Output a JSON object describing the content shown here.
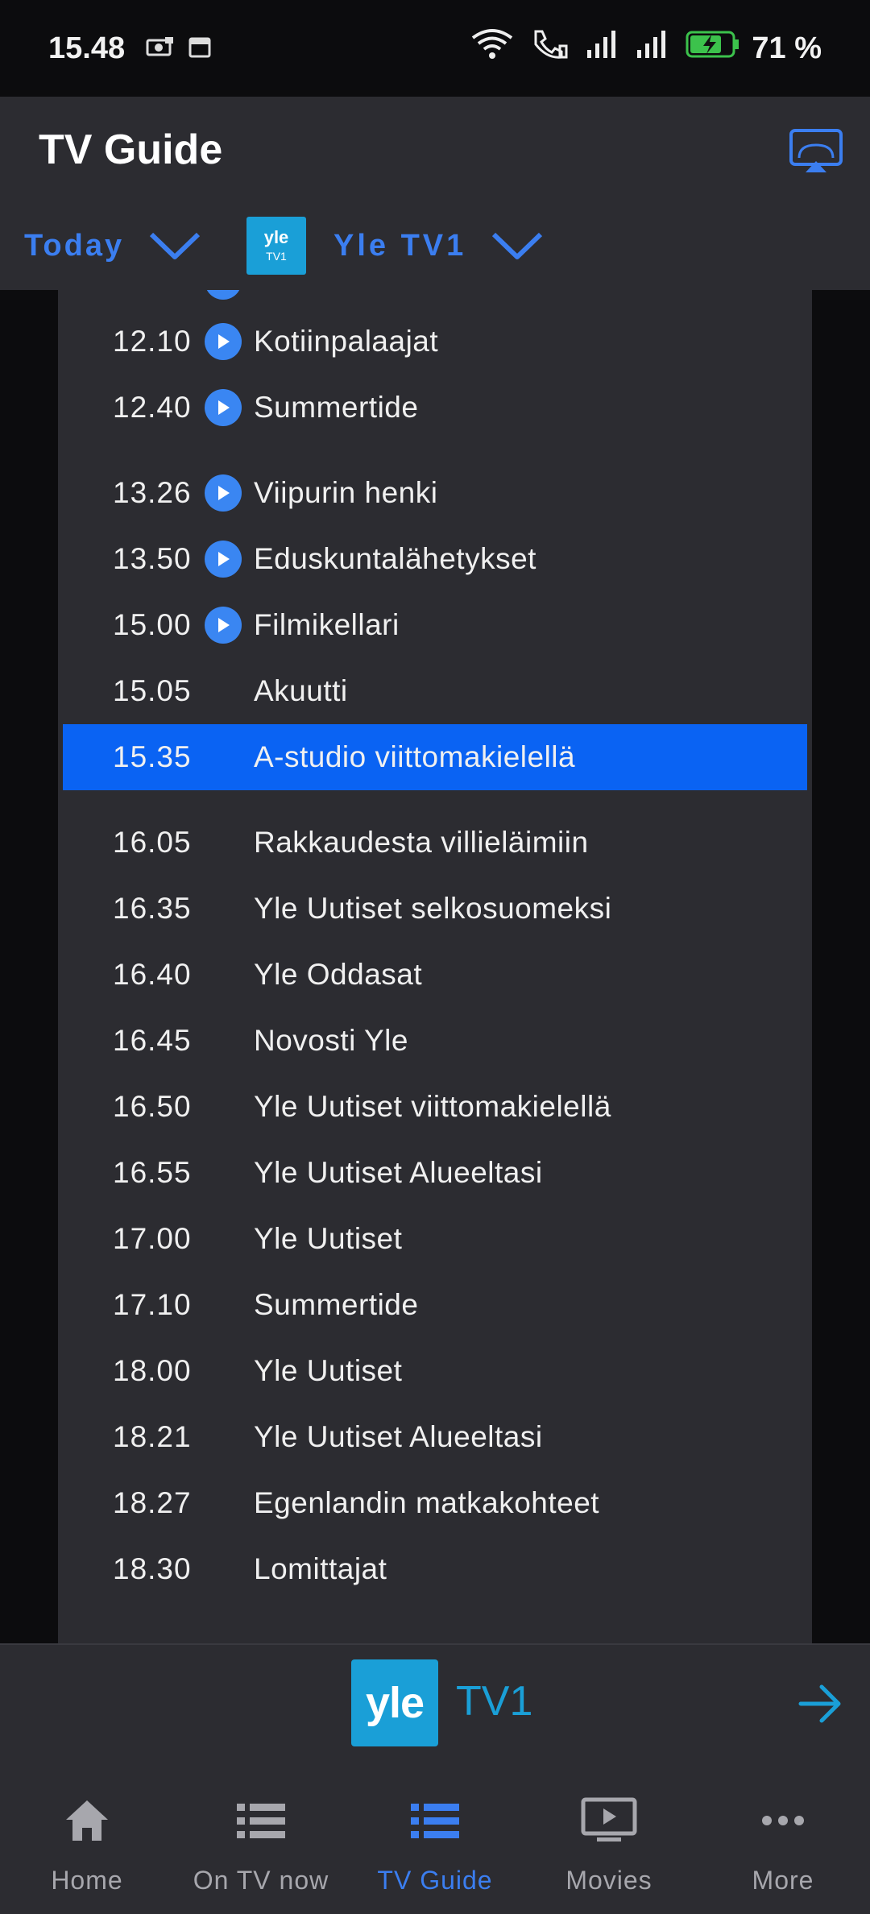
{
  "status_bar": {
    "time": "15.48",
    "battery": "71 %"
  },
  "app_bar": {
    "title": "TV Guide",
    "day": "Today",
    "channel_logo_text": "yle",
    "channel_logo_sub": "TV1",
    "channel": "Yle TV1"
  },
  "schedule": [
    {
      "time": "12.10",
      "title": "Kotiinpalaajat",
      "playable": true
    },
    {
      "time": "12.40",
      "title": "Summertide",
      "playable": true
    },
    {
      "time": "13.26",
      "title": "Viipurin henki",
      "playable": true
    },
    {
      "time": "13.50",
      "title": "Eduskuntalähetykset",
      "playable": true
    },
    {
      "time": "15.00",
      "title": "Filmikellari",
      "playable": true
    },
    {
      "time": "15.05",
      "title": "Akuutti",
      "playable": false
    },
    {
      "time": "15.35",
      "title": "A-studio viittomakielellä",
      "playable": false,
      "now_playing": true
    },
    {
      "time": "16.05",
      "title": "Rakkaudesta villieläimiin",
      "playable": false
    },
    {
      "time": "16.35",
      "title": "Yle Uutiset selkosuomeksi",
      "playable": false
    },
    {
      "time": "16.40",
      "title": "Yle Oddasat",
      "playable": false
    },
    {
      "time": "16.45",
      "title": "Novosti Yle",
      "playable": false
    },
    {
      "time": "16.50",
      "title": "Yle Uutiset viittomakielellä",
      "playable": false
    },
    {
      "time": "16.55",
      "title": "Yle Uutiset Alueeltasi",
      "playable": false
    },
    {
      "time": "17.00",
      "title": "Yle Uutiset",
      "playable": false
    },
    {
      "time": "17.10",
      "title": "Summertide",
      "playable": false
    },
    {
      "time": "18.00",
      "title": "Yle Uutiset",
      "playable": false
    },
    {
      "time": "18.21",
      "title": "Yle Uutiset Alueeltasi",
      "playable": false
    },
    {
      "time": "18.27",
      "title": "Egenlandin matkakohteet",
      "playable": false
    },
    {
      "time": "18.30",
      "title": "Lomittajat",
      "playable": false
    }
  ],
  "channel_bar": {
    "logo_text": "yle",
    "channel_suffix": "TV1"
  },
  "bottom_nav": {
    "items": [
      {
        "label": "Home",
        "icon": "home-icon"
      },
      {
        "label": "On TV now",
        "icon": "list-icon"
      },
      {
        "label": "TV Guide",
        "icon": "list-icon",
        "selected": true
      },
      {
        "label": "Movies",
        "icon": "screen-play-icon"
      },
      {
        "label": "More",
        "icon": "more-dots-icon"
      }
    ]
  },
  "colors": {
    "accent": "#3b7ef0",
    "now_playing_row": "#0a63f3",
    "surface": "#2c2c31",
    "yle_blue": "#1a9fd7"
  }
}
